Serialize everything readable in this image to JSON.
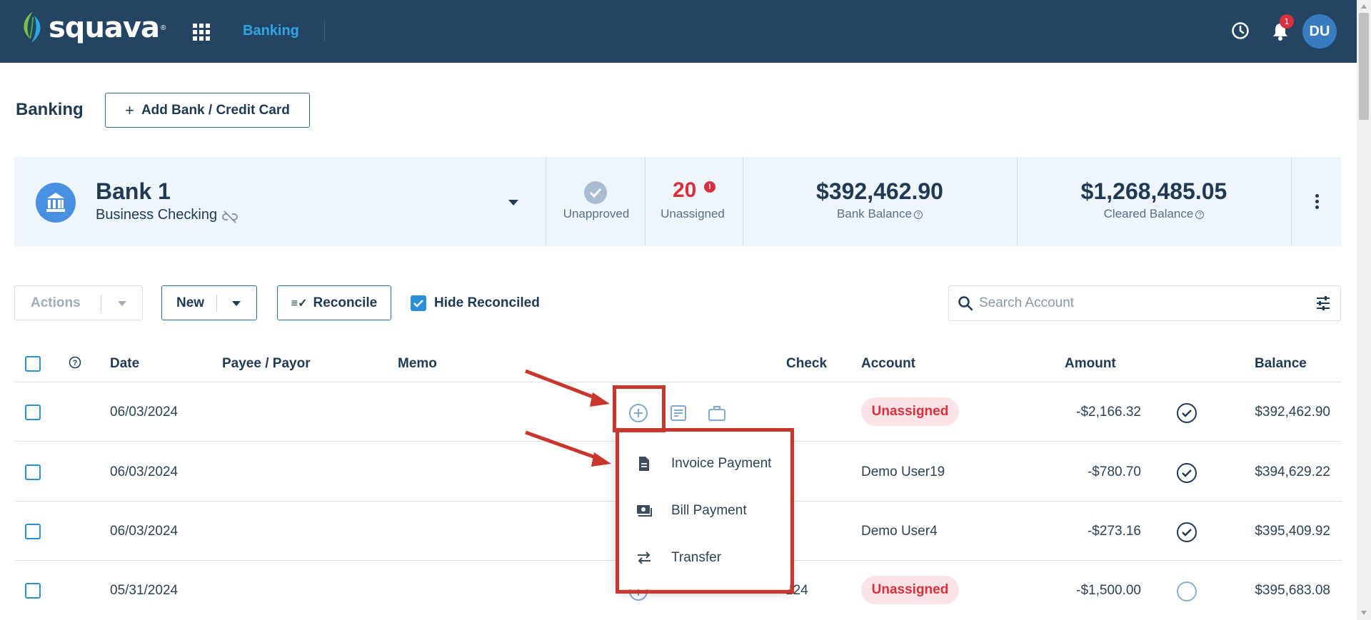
{
  "app": {
    "brand": "squava",
    "nav_active": "Banking"
  },
  "header": {
    "notification_count": "1",
    "avatar_initials": "DU"
  },
  "page": {
    "title": "Banking",
    "add_bank_label": "Add Bank / Credit Card"
  },
  "bank": {
    "name": "Bank 1",
    "type": "Business Checking",
    "unapproved_label": "Unapproved",
    "unassigned_count": "20",
    "unassigned_label": "Unassigned",
    "bank_balance": "$392,462.90",
    "bank_balance_label": "Bank Balance",
    "cleared_balance": "$1,268,485.05",
    "cleared_balance_label": "Cleared Balance"
  },
  "toolbar": {
    "actions_label": "Actions",
    "new_label": "New",
    "reconcile_label": "Reconcile",
    "hide_reconciled_label": "Hide Reconciled",
    "hide_reconciled_checked": true,
    "search_placeholder": "Search Account"
  },
  "table": {
    "headers": [
      "Date",
      "Payee / Payor",
      "Memo",
      "Check",
      "Account",
      "Amount",
      "Balance"
    ],
    "rows": [
      {
        "date": "06/03/2024",
        "check": "",
        "account": "Unassigned",
        "account_unassigned": true,
        "amount": "-$2,166.32",
        "status": "check",
        "balance": "$392,462.90"
      },
      {
        "date": "06/03/2024",
        "check": "",
        "account": "Demo User19",
        "account_unassigned": false,
        "amount": "-$780.70",
        "status": "check",
        "balance": "$394,629.22"
      },
      {
        "date": "06/03/2024",
        "check": "",
        "account": "Demo User4",
        "account_unassigned": false,
        "amount": "-$273.16",
        "status": "check",
        "balance": "$395,409.92"
      },
      {
        "date": "05/31/2024",
        "check": "124",
        "account": "Unassigned",
        "account_unassigned": true,
        "amount": "-$1,500.00",
        "status": "open",
        "balance": "$395,683.08"
      }
    ]
  },
  "add_menu": {
    "items": [
      {
        "label": "Invoice Payment",
        "icon": "document-icon"
      },
      {
        "label": "Bill Payment",
        "icon": "cash-icon"
      },
      {
        "label": "Transfer",
        "icon": "transfer-arrows-icon"
      }
    ]
  },
  "colors": {
    "topbar": "#244562",
    "accent": "#2fa4e7",
    "danger": "#d9303e",
    "annotation": "#c8372d"
  }
}
